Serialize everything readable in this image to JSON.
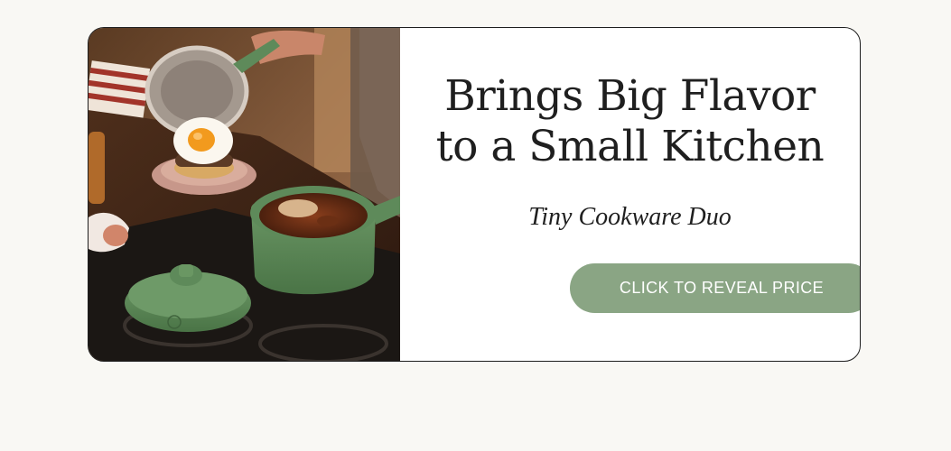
{
  "promo": {
    "image": {
      "subject": "kitchen-scene-green-saucepan-and-fried-egg-sandwich"
    },
    "headline": {
      "line1": "Brings Big Flavor",
      "line2": "to a Small Kitchen"
    },
    "subheadline": "Tiny Cookware Duo",
    "cta_label": "CLICK TO REVEAL PRICE"
  },
  "colors": {
    "page_background": "#f9f8f4",
    "card_background": "#ffffff",
    "card_border": "#1e1e1e",
    "text": "#1f1f1f",
    "cta_background": "#8aa584",
    "cta_text": "#ffffff",
    "cookware_green": "#5e8a5a"
  }
}
